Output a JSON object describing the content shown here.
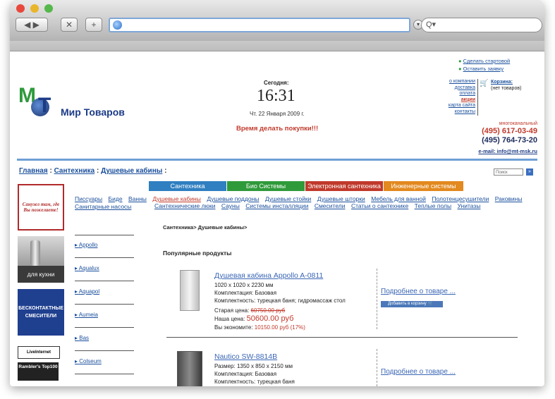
{
  "browser": {
    "url": "",
    "search_placeholder": "Q▾",
    "back_label": "◀ ▶",
    "stop_label": "✕",
    "add_label": "+"
  },
  "header": {
    "logo_letters": "MT",
    "logo_text": "Мир Товаров",
    "today_label": "Сегодня:",
    "time": "16:31",
    "date": "Чт. 22 Января 2009 г.",
    "slogan": "Время делать покупки!!!",
    "top_links": [
      "Сделать стартовой",
      "Оставить заявку"
    ],
    "info_links": [
      "о компании",
      "доставка",
      "оплата",
      "акции",
      "карта сайта",
      "контакты"
    ],
    "cart_label": "Корзина:",
    "cart_status": "(нет товаров)",
    "phone_caption": "многоканальный",
    "phone1": "(495) 617-03-49",
    "phone2": "(495) 764-73-20",
    "email": "e-mail: info@mt-msk.ru"
  },
  "breadcrumb": {
    "items": [
      "Главная",
      "Сантехника",
      "Душевые кабины"
    ],
    "sep": ":"
  },
  "site_search": {
    "placeholder": "Поиск",
    "button": "»"
  },
  "tabs": [
    {
      "label": "Сантехника",
      "color": "#2f7fc1"
    },
    {
      "label": "Био Системы",
      "color": "#2f9a3a"
    },
    {
      "label": "Электронная сантехника",
      "color": "#c0392b"
    },
    {
      "label": "Инженерные системы",
      "color": "#e2891f"
    }
  ],
  "categories_row1": [
    "Писсуары",
    "Биде",
    "Ванны",
    "Душевые кабины",
    "Душевые поддоны",
    "Душевые стойки",
    "Душевые шторки",
    "Мебель для ванной",
    "Полотенцесушители",
    "Раковины",
    "Санитарные насосы"
  ],
  "categories_row2": [
    "Сантехнические люки",
    "Сауны",
    "Системы инсталляции",
    "Смесители",
    "Статьи о сантехнике",
    "Теплые полы",
    "Унитазы"
  ],
  "sidebar": {
    "ad1": "Санузел там, где Вы пожелаете!",
    "ad2": "для кухни",
    "ad3": "БЕСКОНТАКТНЫЕ СМЕСИТЕЛИ",
    "counter1": "LiveInternet",
    "counter2": "Rambler's Top100",
    "brands": [
      "Appollo",
      "Aqualux",
      "Aquapol",
      "Aumeia",
      "Bas",
      "Colseum"
    ]
  },
  "main": {
    "path": "Сантехника> Душевые кабины>",
    "section_title": "Популярные продукты",
    "products": [
      {
        "title": "Душевая кабина Appollo A-0811",
        "size": "1020 x 1020 x 2230 мм",
        "kit": "Комплектация: Базовая",
        "features": "Комплектность: турецкая баня; гидромассаж стол",
        "old_price_label": "Старая цена:",
        "old_price": "60750.00 руб",
        "price_label": "Наша цена:",
        "price": "50600.00 руб",
        "save_label": "Вы экономите:",
        "save": "10150.00 руб (17%)",
        "more": "Подробнее о товаре ...",
        "cart_button": "Добавить в корзину"
      },
      {
        "title": "Nautico SW-8814B",
        "size": "Размер: 1350 x 850 x 2150 мм",
        "kit": "Комплектация: Базовая",
        "features": "Комплектность: турецкая баня",
        "more": "Подробнее о товаре ..."
      }
    ]
  }
}
